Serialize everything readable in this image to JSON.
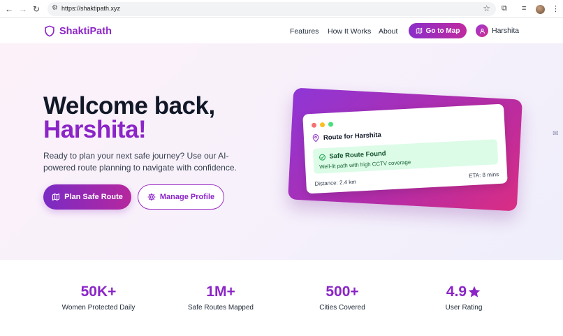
{
  "browser": {
    "url": "https://shaktipath.xyz"
  },
  "header": {
    "brand": "ShaktiPath",
    "nav": [
      {
        "label": "Features"
      },
      {
        "label": "How It Works"
      },
      {
        "label": "About"
      }
    ],
    "map_button": "Go to Map",
    "user_name": "Harshita"
  },
  "hero": {
    "title_line1": "Welcome back,",
    "title_line2": "Harshita!",
    "subtitle": "Ready to plan your next safe journey? Use our AI-powered route planning to navigate with confidence.",
    "primary_button": "Plan Safe Route",
    "secondary_button": "Manage Profile"
  },
  "route_card": {
    "title": "Route for Harshita",
    "status_title": "Safe Route Found",
    "status_desc": "Well-lit path with high CCTV coverage",
    "distance": "Distance: 2.4 km",
    "eta": "ETA: 8 mins"
  },
  "stats": [
    {
      "value": "50K+",
      "label": "Women Protected Daily"
    },
    {
      "value": "1M+",
      "label": "Safe Routes Mapped"
    },
    {
      "value": "500+",
      "label": "Cities Covered"
    },
    {
      "value": "4.9",
      "label": "User Rating"
    }
  ],
  "colors": {
    "brand_purple": "#8b25c7",
    "brand_pink": "#d92d84",
    "success_bg": "#dcfce7"
  }
}
